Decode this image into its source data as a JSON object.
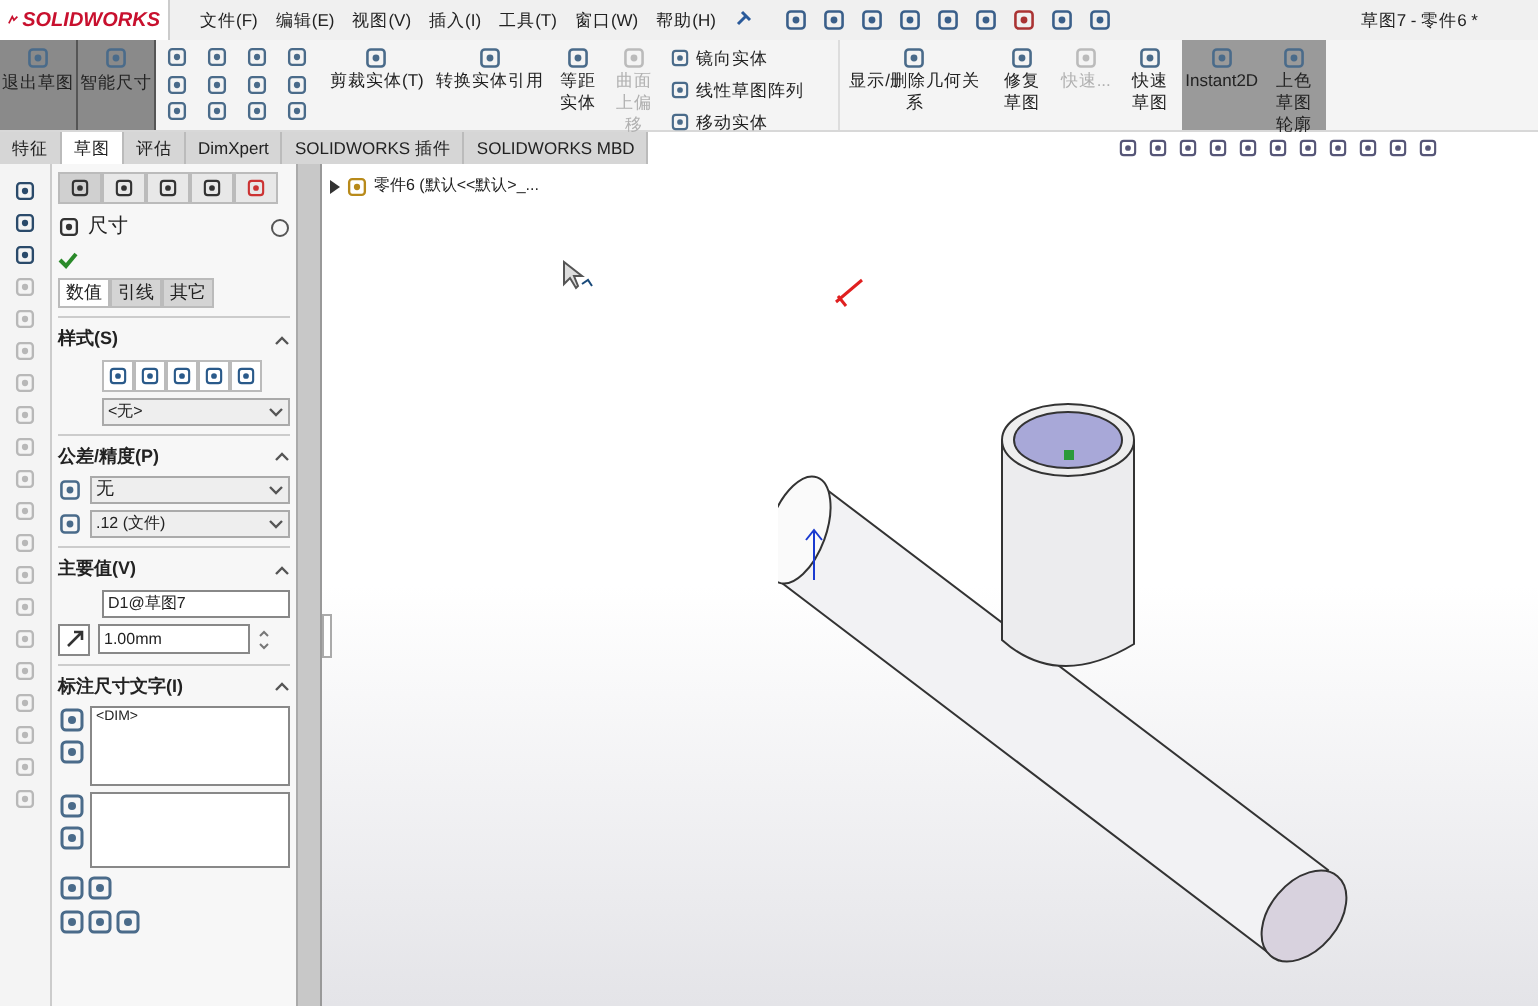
{
  "logo": {
    "text": "SOLIDWORKS"
  },
  "menu": [
    "文件(F)",
    "编辑(E)",
    "视图(V)",
    "插入(I)",
    "工具(T)",
    "窗口(W)",
    "帮助(H)"
  ],
  "document_title": "草图7 - 零件6 *",
  "ribbon": {
    "main_buttons": [
      {
        "label": "退出草图",
        "selected": true
      },
      {
        "label": "智能尺寸",
        "selected": true
      }
    ],
    "tools": [
      {
        "label": "剪裁实体(T)",
        "disabled": false,
        "selected": false
      },
      {
        "label": "转换实体引用",
        "disabled": false,
        "selected": false
      },
      {
        "label": "等距实体",
        "disabled": false,
        "selected": false
      },
      {
        "label": "曲面上偏移",
        "disabled": true,
        "selected": false
      }
    ],
    "list_tools": [
      "镜向实体",
      "线性草图阵列",
      "移动实体"
    ],
    "right_tools": [
      {
        "label": "显示/删除几何关系",
        "disabled": false,
        "selected": false
      },
      {
        "label": "修复草图",
        "disabled": false,
        "selected": false
      },
      {
        "label": "快速...",
        "disabled": true,
        "selected": false
      },
      {
        "label": "快速草图",
        "disabled": false,
        "selected": false
      },
      {
        "label": "Instant2D",
        "disabled": false,
        "selected": true
      },
      {
        "label": "上色草图轮廓",
        "disabled": false,
        "selected": true
      }
    ]
  },
  "command_tabs": [
    {
      "label": "特征",
      "selected": false
    },
    {
      "label": "草图",
      "selected": true
    },
    {
      "label": "评估",
      "selected": false
    },
    {
      "label": "DimXpert",
      "selected": false
    },
    {
      "label": "SOLIDWORKS 插件",
      "selected": false
    },
    {
      "label": "SOLIDWORKS MBD",
      "selected": false
    }
  ],
  "feature_tree": {
    "item": "零件6 (默认<<默认>_..."
  },
  "property_manager": {
    "title": "尺寸",
    "tabs": [
      {
        "label": "数值",
        "selected": true
      },
      {
        "label": "引线",
        "selected": false
      },
      {
        "label": "其它",
        "selected": false
      }
    ],
    "style": {
      "heading": "样式(S)",
      "value": "<无>"
    },
    "tolerance": {
      "heading": "公差/精度(P)",
      "type": "无",
      "precision": ".12 (文件)"
    },
    "primary": {
      "heading": "主要值(V)",
      "name": "D1@草图7",
      "value": "1.00mm"
    },
    "dim_text": {
      "heading": "标注尺寸文字(I)",
      "value": "<DIM>"
    }
  }
}
